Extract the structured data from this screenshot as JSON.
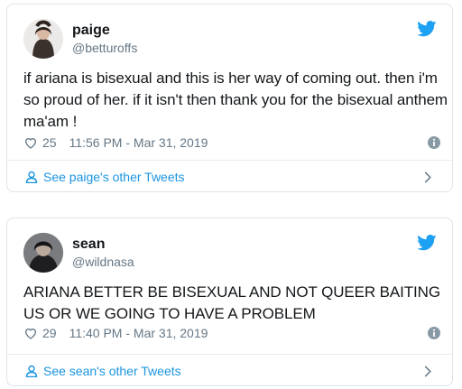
{
  "colors": {
    "twitter_blue": "#1da1f2",
    "link_blue": "#1b95e0",
    "secondary_text": "#657786",
    "border": "#dfe3e8"
  },
  "tweets": [
    {
      "display_name": "paige",
      "handle": "@betturoffs",
      "text": "if ariana is bisexual and this is her way of coming out. then i'm so proud of her. if it isn't then thank you for the bisexual anthem ma'am !",
      "likes": "25",
      "timestamp": "11:56 PM - Mar 31, 2019",
      "other_tweets_label": "See paige's other Tweets",
      "icons": [
        "twitter-bird-icon",
        "heart-icon",
        "info-icon",
        "person-icon",
        "chevron-right-icon"
      ]
    },
    {
      "display_name": "sean",
      "handle": "@wildnasa",
      "text": "ARIANA BETTER BE BISEXUAL AND NOT QUEER BAITING US OR WE GOING TO HAVE A PROBLEM",
      "likes": "29",
      "timestamp": "11:40 PM - Mar 31, 2019",
      "other_tweets_label": "See sean's other Tweets",
      "icons": [
        "twitter-bird-icon",
        "heart-icon",
        "info-icon",
        "person-icon",
        "chevron-right-icon"
      ]
    }
  ]
}
